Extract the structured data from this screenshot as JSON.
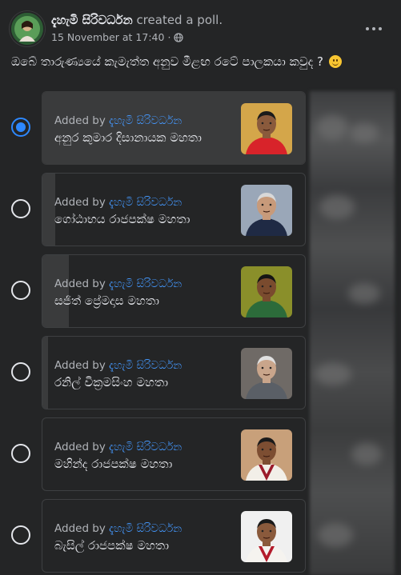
{
  "post": {
    "author_name": "දැහැමි සිරිවර්ධන",
    "author_action": "created a poll.",
    "timestamp": "15 November at 17:40",
    "separator": "·",
    "privacy_icon": "globe-icon",
    "more_icon": "more-options-icon",
    "question": "ඔබේ තාරුණ්‍යයේ කැමැත්ත අනුව මීළඟ රටේ පාලකයා කවුද ?",
    "question_emoji": "slightly-smiling-face"
  },
  "poll": {
    "added_by_prefix": "Added by",
    "options": [
      {
        "added_by": "දැහැමි සිරිවර්ධන",
        "label": "අනුර කුමාර දිසානායක මහතා",
        "selected": true,
        "fill_fraction": 1.0
      },
      {
        "added_by": "දැහැමි සිරිවර්ධන",
        "label": "ගෝඨාභය රාජපක්ෂ මහතා",
        "selected": false,
        "fill_fraction": 0.05
      },
      {
        "added_by": "දැහැමි සිරිවර්ධන",
        "label": "සජිත් ප්‍රේමදාස මහතා",
        "selected": false,
        "fill_fraction": 0.1
      },
      {
        "added_by": "දැහැමි සිරිවර්ධන",
        "label": "රනිල් වික්‍රමසිංහ මහතා",
        "selected": false,
        "fill_fraction": 0.02
      },
      {
        "added_by": "දැහැමි සිරිවර්ධන",
        "label": "මහින්ද රාජපක්ෂ මහතා",
        "selected": false,
        "fill_fraction": 0.0
      },
      {
        "added_by": "දැහැමි සිරිවර්ධන",
        "label": "බැසිල් රාජපක්ෂ මහතා",
        "selected": false,
        "fill_fraction": 0.0
      }
    ]
  },
  "colors": {
    "background": "#242526",
    "accent": "#2d88ff",
    "link": "#4599ff",
    "text": "#e4e6eb",
    "secondary_text": "#b0b3b8"
  }
}
